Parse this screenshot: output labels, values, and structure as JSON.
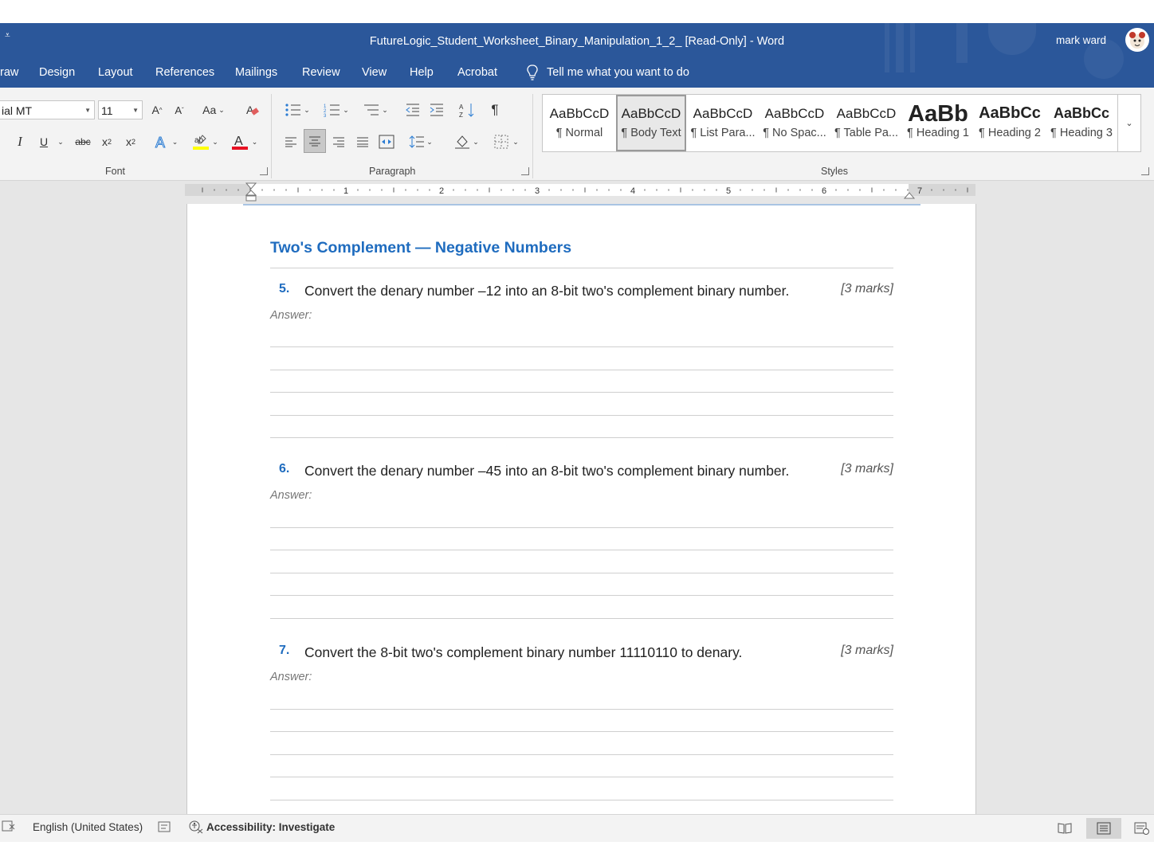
{
  "window": {
    "title": "FutureLogic_Student_Worksheet_Binary_Manipulation_1_2_ [Read-Only]  -  Word",
    "user": "mark ward",
    "qat_glyph": "⩡"
  },
  "tabs": [
    {
      "label": "raw"
    },
    {
      "label": "Design"
    },
    {
      "label": "Layout"
    },
    {
      "label": "References"
    },
    {
      "label": "Mailings"
    },
    {
      "label": "Review"
    },
    {
      "label": "View"
    },
    {
      "label": "Help"
    },
    {
      "label": "Acrobat"
    }
  ],
  "tell_me": "Tell me what you want to do",
  "ribbon": {
    "font_name": "ial MT",
    "font_size": "11",
    "groups": {
      "font": "Font",
      "paragraph": "Paragraph",
      "styles": "Styles"
    },
    "highlight_color": "#ffff00",
    "font_color": "#e81123",
    "styles": [
      {
        "preview": "AaBbCcD",
        "name": "¶ Normal"
      },
      {
        "preview": "AaBbCcD",
        "name": "¶ Body Text"
      },
      {
        "preview": "AaBbCcD",
        "name": "¶ List Para..."
      },
      {
        "preview": "AaBbCcD",
        "name": "¶ No Spac..."
      },
      {
        "preview": "AaBbCcD",
        "name": "¶ Table Pa..."
      },
      {
        "preview": "AaBb",
        "name": "¶ Heading 1"
      },
      {
        "preview": "AaBbCc",
        "name": "¶ Heading 2"
      },
      {
        "preview": "AaBbCc",
        "name": "¶ Heading 3"
      }
    ]
  },
  "ruler": {
    "numbers": [
      "1",
      "2",
      "3",
      "4",
      "5",
      "6",
      "7"
    ]
  },
  "document": {
    "section_title": "Two's Complement — Negative Numbers",
    "questions": [
      {
        "num": "5.",
        "text": "Convert the denary number –12 into an 8-bit two's complement binary number.",
        "marks": "[3 marks]",
        "answer_label": "Answer:"
      },
      {
        "num": "6.",
        "text": "Convert the denary number –45 into an 8-bit two's complement binary number.",
        "marks": "[3 marks]",
        "answer_label": "Answer:"
      },
      {
        "num": "7.",
        "text": "Convert the 8-bit two's complement binary number 11110110 to denary.",
        "marks": "[3 marks]",
        "answer_label": "Answer:"
      }
    ]
  },
  "status": {
    "language": "English (United States)",
    "accessibility": "Accessibility: Investigate"
  },
  "colors": {
    "title_bar": "#2b579a",
    "heading_blue": "#1f6cbf"
  }
}
